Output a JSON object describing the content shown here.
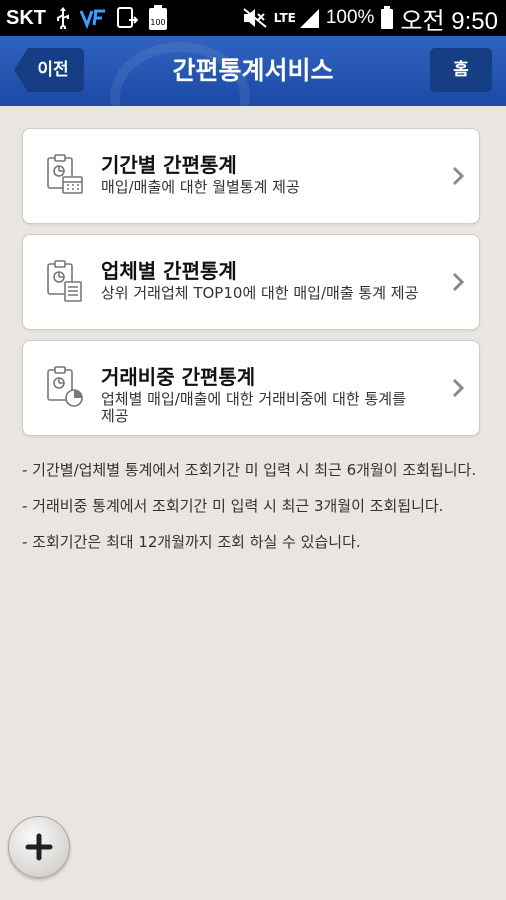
{
  "status_bar": {
    "carrier": "SKT",
    "network": "LTE",
    "battery_percent": "100%",
    "clock": "오전 9:50",
    "battery_badge": "100"
  },
  "header": {
    "back_label": "이전",
    "title": "간편통계서비스",
    "home_label": "홈"
  },
  "menu": [
    {
      "title": "기간별 간편통계",
      "desc": "매입/매출에 대한 월별통계 제공",
      "icon": "calendar-chart-icon"
    },
    {
      "title": "업체별 간편통계",
      "desc": "상위 거래업체 TOP10에 대한 매입/매출 통계 제공",
      "icon": "list-chart-icon"
    },
    {
      "title": "거래비중 간편통계",
      "desc": "업체별 매입/매출에 대한 거래비중에 대한 통계를 제공",
      "icon": "pie-chart-icon"
    }
  ],
  "notes": [
    "- 기간별/업체별 통계에서 조회기간 미 입력 시 최근 6개월이 조회됩니다.",
    "- 거래비중 통계에서 조회기간 미 입력 시 최근 3개월이 조회됩니다.",
    "- 조회기간은 최대 12개월까지 조회 하실 수 있습니다."
  ],
  "colors": {
    "header_blue": "#1c4aa6",
    "button_blue": "#153e85",
    "background": "#e9e6e1"
  }
}
